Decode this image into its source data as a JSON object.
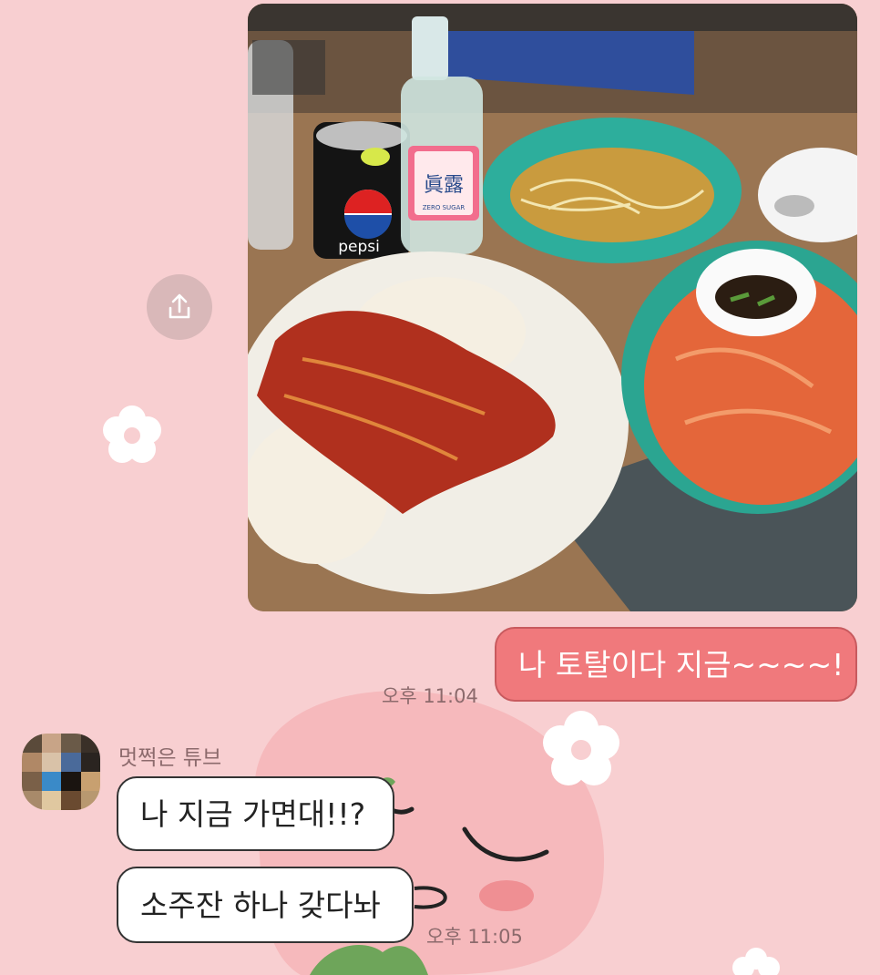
{
  "chat": {
    "sent_message": "나 토탈이다 지금~~~~!",
    "sent_time": "오후 11:04",
    "contact_name": "멋쩍은 튜브",
    "received_messages": [
      "나 지금 가면대!!?",
      "소주잔 하나 갖다놔"
    ],
    "received_time": "오후 11:05"
  },
  "photo": {
    "can_label": "pepsi",
    "bottle_label": "眞露",
    "bottle_sublabel": "ZERO SUGAR"
  },
  "icons": {
    "share": "share-icon",
    "avatar": "avatar-image"
  },
  "colors": {
    "background": "#f8cfd1",
    "sent_bubble": "#f0797c",
    "received_bubble": "#ffffff",
    "time_text": "#8c6a6c"
  }
}
